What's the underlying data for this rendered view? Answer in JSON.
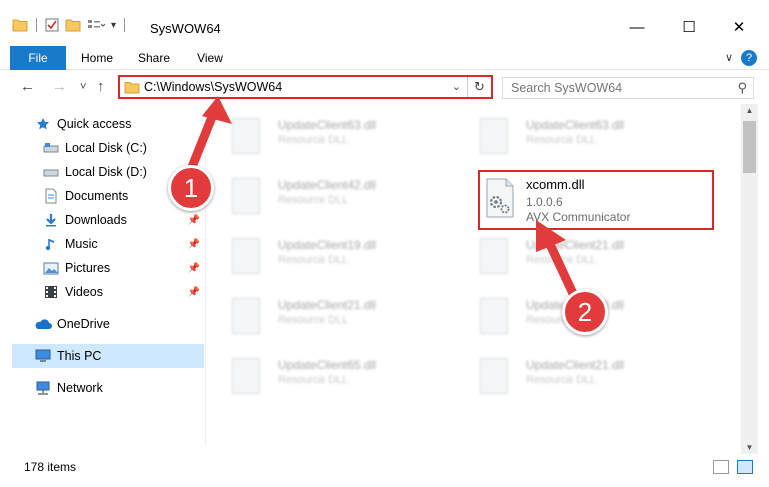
{
  "window": {
    "title": "SysWOW64",
    "minimize": "—",
    "maximize": "☐",
    "close": "✕"
  },
  "ribbon": {
    "tabs": [
      "File",
      "Home",
      "Share",
      "View"
    ],
    "help": "?",
    "chevron": "∨"
  },
  "nav": {
    "back": "←",
    "forward": "→",
    "recent": "˅",
    "up": "↑",
    "address_path": "C:\\Windows\\SysWOW64",
    "search_placeholder": "Search SysWOW64"
  },
  "sidebar": {
    "items": [
      {
        "label": "Quick access",
        "icon": "star-icon"
      },
      {
        "label": "Local Disk (C:)",
        "icon": "drive-icon"
      },
      {
        "label": "Local Disk (D:)",
        "icon": "drive-icon"
      },
      {
        "label": "Documents",
        "icon": "documents-icon"
      },
      {
        "label": "Downloads",
        "icon": "download-icon"
      },
      {
        "label": "Music",
        "icon": "music-icon"
      },
      {
        "label": "Pictures",
        "icon": "pictures-icon"
      },
      {
        "label": "Videos",
        "icon": "videos-icon"
      },
      {
        "label": "OneDrive",
        "icon": "cloud-icon"
      },
      {
        "label": "This PC",
        "icon": "computer-icon"
      },
      {
        "label": "Network",
        "icon": "network-icon"
      }
    ]
  },
  "files": {
    "blurred": [
      {
        "name": "UpdateClient63.dll",
        "type": "Resource DLL"
      },
      {
        "name": "UpdateClient63.dll",
        "type": "Resource DLL"
      },
      {
        "name": "UpdateClient42.dll",
        "type": "Resource DLL"
      },
      {
        "name": "UpdateClient19.dll",
        "type": "Resource DLL"
      },
      {
        "name": "UpdateClient21.dll",
        "type": "Resource DLL"
      },
      {
        "name": "UpdateClient21.dll",
        "type": "Resource DLL"
      },
      {
        "name": "UpdateClient19.dll",
        "type": "Resource DLL"
      },
      {
        "name": "UpdateClient65.dll",
        "type": "Resource DLL"
      },
      {
        "name": "UpdateClient21.dll",
        "type": "Resource DLL"
      }
    ],
    "highlighted": {
      "name": "xcomm.dll",
      "version": "1.0.0.6",
      "description": "AVX Communicator"
    }
  },
  "status": {
    "item_count": "178 items"
  },
  "annotations": {
    "marker1": "1",
    "marker2": "2",
    "color": "#e23b3b"
  }
}
